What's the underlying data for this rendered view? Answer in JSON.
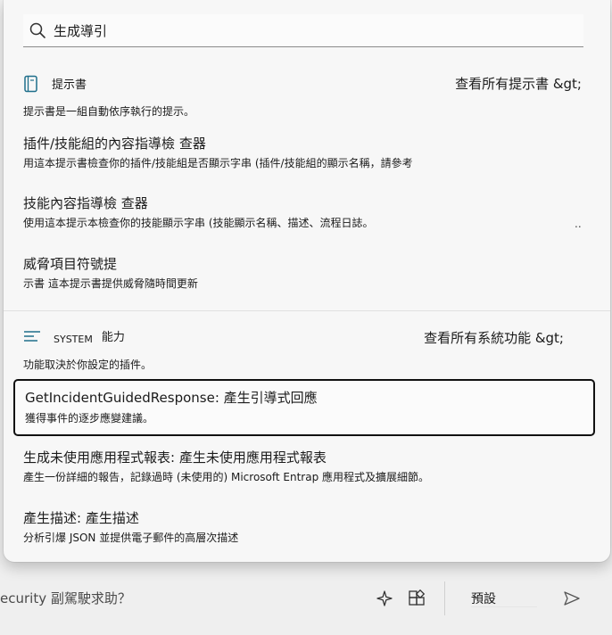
{
  "search": {
    "value": "生成導引",
    "placeholder": ""
  },
  "promptbooks": {
    "title": "提示書",
    "view_all": "查看所有提示書 &gt;",
    "description": "提示書是一組自動依序執行的提示。",
    "items": [
      {
        "title": "插件/技能組的內容指導檢 查器",
        "desc": "用這本提示書檢查你的插件/技能組是否顯示字串 (插件/技能組的顯示名稱，請參考"
      },
      {
        "title": "技能內容指導檢 查器",
        "desc": "使用這本提示本檢查你的技能顯示字串 (技能顯示名稱、描述、流程日誌。"
      },
      {
        "title": "威脅項目符號提",
        "desc": "示書 這本提示書提供威脅隨時間更新"
      }
    ],
    "ellipsis": ".."
  },
  "system": {
    "badge": "SYSTEM",
    "title": "能力",
    "view_all": "查看所有系統功能 &gt;",
    "description": "功能取決於你設定的插件。",
    "items": [
      {
        "title": "GetIncidentGuidedResponse: 產生引導式回應",
        "desc": "獲得事件的逐步應變建議。"
      },
      {
        "title": "生成未使用應用程式報表: 產生未使用應用程式報表",
        "desc": "產生一份詳細的報告，記錄過時 (未使用的) Microsoft Entrap 應用程式及擴展細節。"
      },
      {
        "title": "產生描述: 產生描述",
        "desc": "分析引爆 JSON 並提供電子郵件的高層次描述"
      }
    ]
  },
  "bottom": {
    "prompt_text": "ecurity 副駕駛求助？",
    "preset_label": "預設"
  },
  "icons": {
    "search": "search-icon",
    "promptbook": "promptbook-icon",
    "system": "system-lines-icon",
    "sparkle": "sparkle-icon",
    "plugins": "plugins-icon",
    "send": "send-icon"
  },
  "colors": {
    "accent": "#1f6f8b",
    "selected_border": "#111111"
  }
}
